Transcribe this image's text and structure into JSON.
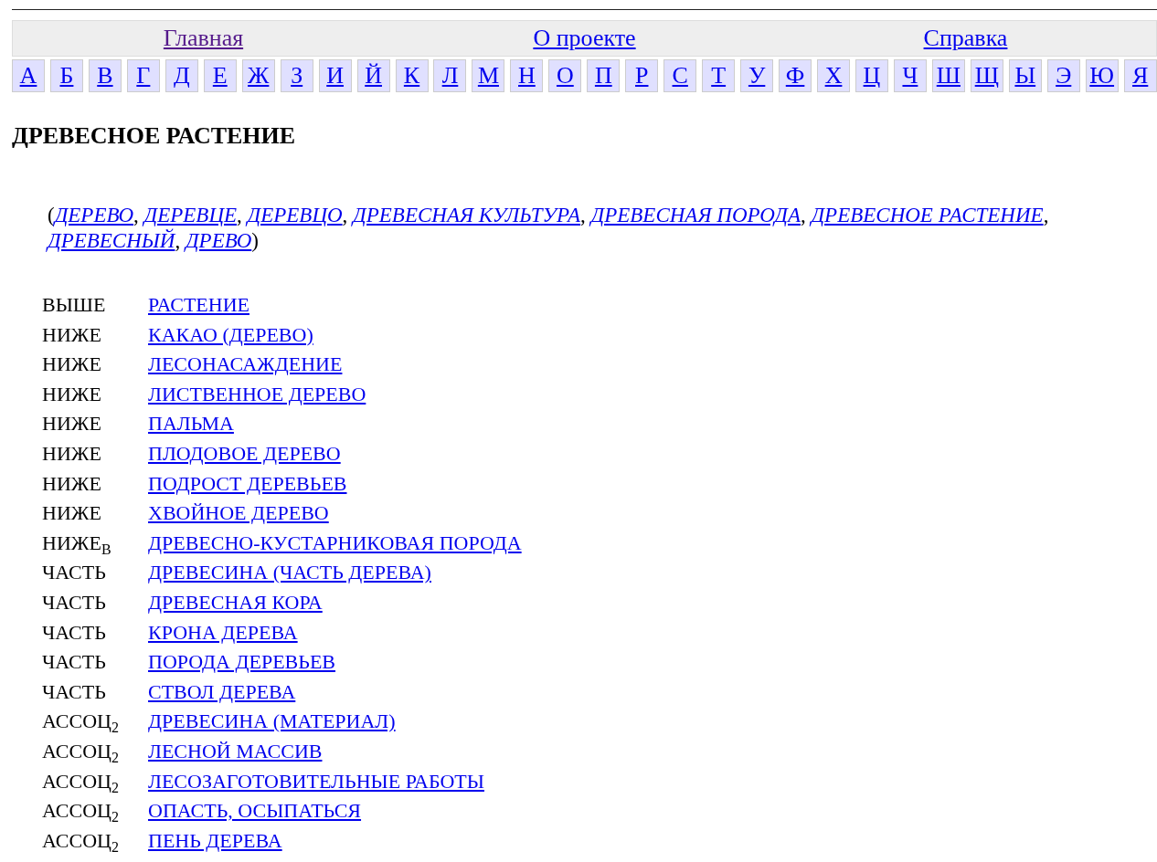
{
  "nav": [
    {
      "label": "Главная",
      "visited": true
    },
    {
      "label": "О проекте",
      "visited": false
    },
    {
      "label": "Справка",
      "visited": false
    }
  ],
  "letters": [
    "А",
    "Б",
    "В",
    "Г",
    "Д",
    "Е",
    "Ж",
    "З",
    "И",
    "Й",
    "К",
    "Л",
    "М",
    "Н",
    "О",
    "П",
    "Р",
    "С",
    "Т",
    "У",
    "Ф",
    "Х",
    "Ц",
    "Ч",
    "Ш",
    "Щ",
    "Ы",
    "Э",
    "Ю",
    "Я"
  ],
  "title": "ДРЕВЕСНОЕ РАСТЕНИЕ",
  "synonyms_open": "(",
  "synonyms_close": ")",
  "synonyms_separator": ",",
  "synonyms": [
    "ДЕРЕВО",
    "ДЕРЕВЦЕ",
    "ДЕРЕВЦО",
    "ДРЕВЕСНАЯ КУЛЬТУРА",
    "ДРЕВЕСНАЯ ПОРОДА",
    "ДРЕВЕСНОЕ РАСТЕНИЕ",
    "ДРЕВЕСНЫЙ",
    "ДРЕВО"
  ],
  "relations": [
    {
      "relation": "ВЫШЕ",
      "concept": "РАСТЕНИЕ"
    },
    {
      "relation": "НИЖЕ",
      "concept": "КАКАО (ДЕРЕВО)"
    },
    {
      "relation": "НИЖЕ",
      "concept": "ЛЕСОНАСАЖДЕНИЕ"
    },
    {
      "relation": "НИЖЕ",
      "concept": "ЛИСТВЕННОЕ ДЕРЕВО"
    },
    {
      "relation": "НИЖЕ",
      "concept": "ПАЛЬМА"
    },
    {
      "relation": "НИЖЕ",
      "concept": "ПЛОДОВОЕ ДЕРЕВО"
    },
    {
      "relation": "НИЖЕ",
      "concept": "ПОДРОСТ ДЕРЕВЬЕВ"
    },
    {
      "relation": "НИЖЕ",
      "concept": "ХВОЙНОЕ ДЕРЕВО"
    },
    {
      "relation": "НИЖЕ$_{В}$",
      "concept": "ДРЕВЕСНО-КУСТАРНИКОВАЯ ПОРОДА"
    },
    {
      "relation": "ЧАСТЬ",
      "concept": "ДРЕВЕСИНА (ЧАСТЬ ДЕРЕВА)"
    },
    {
      "relation": "ЧАСТЬ",
      "concept": "ДРЕВЕСНАЯ КОРА"
    },
    {
      "relation": "ЧАСТЬ",
      "concept": "КРОНА ДЕРЕВА"
    },
    {
      "relation": "ЧАСТЬ",
      "concept": "ПОРОДА ДЕРЕВЬЕВ"
    },
    {
      "relation": "ЧАСТЬ",
      "concept": "СТВОЛ ДЕРЕВА"
    },
    {
      "relation": "АССОЦ$_{2}$",
      "concept": "ДРЕВЕСИНА (МАТЕРИАЛ)"
    },
    {
      "relation": "АССОЦ$_{2}$",
      "concept": "ЛЕСНОЙ МАССИВ"
    },
    {
      "relation": "АССОЦ$_{2}$",
      "concept": "ЛЕСОЗАГОТОВИТЕЛЬНЫЕ РАБОТЫ"
    },
    {
      "relation": "АССОЦ$_{2}$",
      "concept": "ОПАСТЬ, ОСЫПАТЬСЯ"
    },
    {
      "relation": "АССОЦ$_{2}$",
      "concept": "ПЕНЬ ДЕРЕВА"
    }
  ]
}
